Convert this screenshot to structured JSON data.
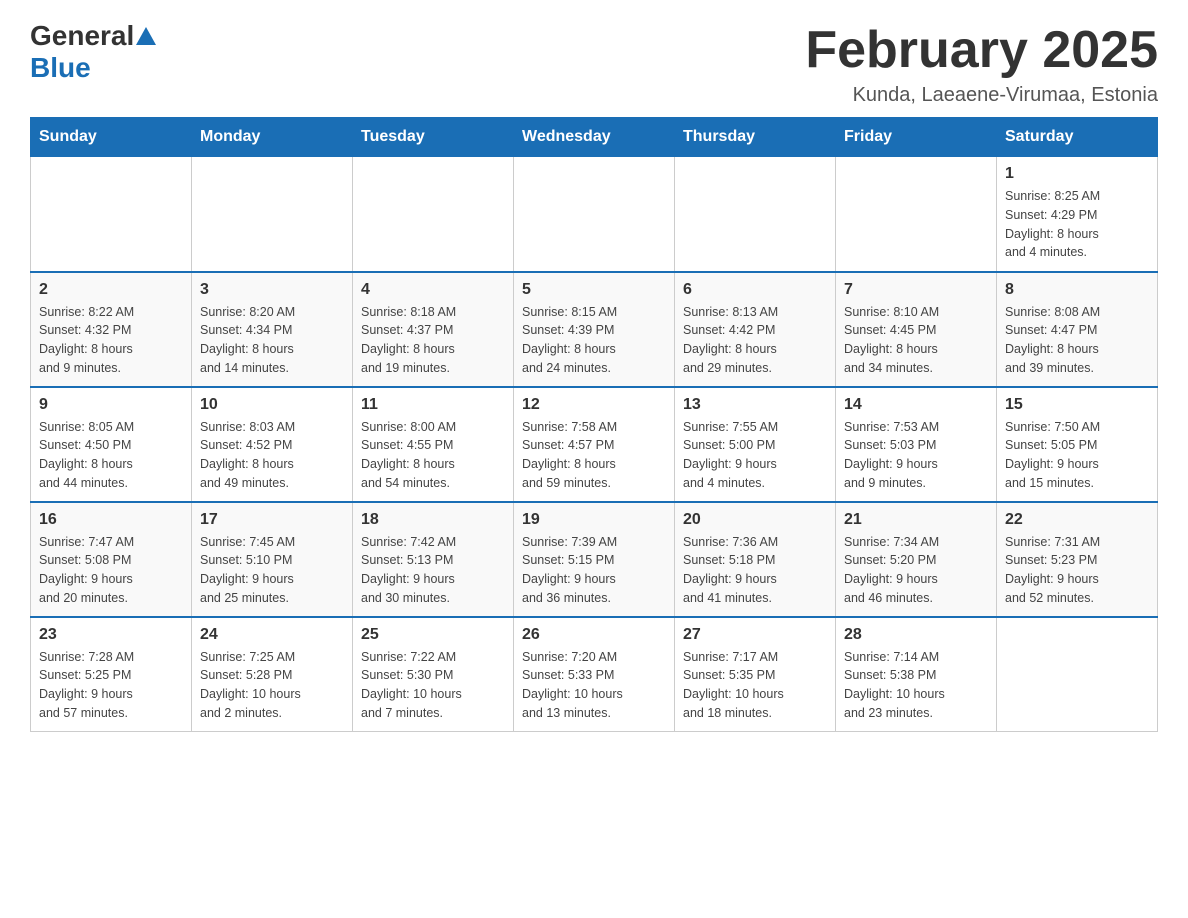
{
  "header": {
    "logo_general": "General",
    "logo_blue": "Blue",
    "month_title": "February 2025",
    "location": "Kunda, Laeaene-Virumaa, Estonia"
  },
  "days_of_week": [
    "Sunday",
    "Monday",
    "Tuesday",
    "Wednesday",
    "Thursday",
    "Friday",
    "Saturday"
  ],
  "weeks": [
    {
      "days": [
        {
          "date": "",
          "info": ""
        },
        {
          "date": "",
          "info": ""
        },
        {
          "date": "",
          "info": ""
        },
        {
          "date": "",
          "info": ""
        },
        {
          "date": "",
          "info": ""
        },
        {
          "date": "",
          "info": ""
        },
        {
          "date": "1",
          "info": "Sunrise: 8:25 AM\nSunset: 4:29 PM\nDaylight: 8 hours\nand 4 minutes."
        }
      ]
    },
    {
      "days": [
        {
          "date": "2",
          "info": "Sunrise: 8:22 AM\nSunset: 4:32 PM\nDaylight: 8 hours\nand 9 minutes."
        },
        {
          "date": "3",
          "info": "Sunrise: 8:20 AM\nSunset: 4:34 PM\nDaylight: 8 hours\nand 14 minutes."
        },
        {
          "date": "4",
          "info": "Sunrise: 8:18 AM\nSunset: 4:37 PM\nDaylight: 8 hours\nand 19 minutes."
        },
        {
          "date": "5",
          "info": "Sunrise: 8:15 AM\nSunset: 4:39 PM\nDaylight: 8 hours\nand 24 minutes."
        },
        {
          "date": "6",
          "info": "Sunrise: 8:13 AM\nSunset: 4:42 PM\nDaylight: 8 hours\nand 29 minutes."
        },
        {
          "date": "7",
          "info": "Sunrise: 8:10 AM\nSunset: 4:45 PM\nDaylight: 8 hours\nand 34 minutes."
        },
        {
          "date": "8",
          "info": "Sunrise: 8:08 AM\nSunset: 4:47 PM\nDaylight: 8 hours\nand 39 minutes."
        }
      ]
    },
    {
      "days": [
        {
          "date": "9",
          "info": "Sunrise: 8:05 AM\nSunset: 4:50 PM\nDaylight: 8 hours\nand 44 minutes."
        },
        {
          "date": "10",
          "info": "Sunrise: 8:03 AM\nSunset: 4:52 PM\nDaylight: 8 hours\nand 49 minutes."
        },
        {
          "date": "11",
          "info": "Sunrise: 8:00 AM\nSunset: 4:55 PM\nDaylight: 8 hours\nand 54 minutes."
        },
        {
          "date": "12",
          "info": "Sunrise: 7:58 AM\nSunset: 4:57 PM\nDaylight: 8 hours\nand 59 minutes."
        },
        {
          "date": "13",
          "info": "Sunrise: 7:55 AM\nSunset: 5:00 PM\nDaylight: 9 hours\nand 4 minutes."
        },
        {
          "date": "14",
          "info": "Sunrise: 7:53 AM\nSunset: 5:03 PM\nDaylight: 9 hours\nand 9 minutes."
        },
        {
          "date": "15",
          "info": "Sunrise: 7:50 AM\nSunset: 5:05 PM\nDaylight: 9 hours\nand 15 minutes."
        }
      ]
    },
    {
      "days": [
        {
          "date": "16",
          "info": "Sunrise: 7:47 AM\nSunset: 5:08 PM\nDaylight: 9 hours\nand 20 minutes."
        },
        {
          "date": "17",
          "info": "Sunrise: 7:45 AM\nSunset: 5:10 PM\nDaylight: 9 hours\nand 25 minutes."
        },
        {
          "date": "18",
          "info": "Sunrise: 7:42 AM\nSunset: 5:13 PM\nDaylight: 9 hours\nand 30 minutes."
        },
        {
          "date": "19",
          "info": "Sunrise: 7:39 AM\nSunset: 5:15 PM\nDaylight: 9 hours\nand 36 minutes."
        },
        {
          "date": "20",
          "info": "Sunrise: 7:36 AM\nSunset: 5:18 PM\nDaylight: 9 hours\nand 41 minutes."
        },
        {
          "date": "21",
          "info": "Sunrise: 7:34 AM\nSunset: 5:20 PM\nDaylight: 9 hours\nand 46 minutes."
        },
        {
          "date": "22",
          "info": "Sunrise: 7:31 AM\nSunset: 5:23 PM\nDaylight: 9 hours\nand 52 minutes."
        }
      ]
    },
    {
      "days": [
        {
          "date": "23",
          "info": "Sunrise: 7:28 AM\nSunset: 5:25 PM\nDaylight: 9 hours\nand 57 minutes."
        },
        {
          "date": "24",
          "info": "Sunrise: 7:25 AM\nSunset: 5:28 PM\nDaylight: 10 hours\nand 2 minutes."
        },
        {
          "date": "25",
          "info": "Sunrise: 7:22 AM\nSunset: 5:30 PM\nDaylight: 10 hours\nand 7 minutes."
        },
        {
          "date": "26",
          "info": "Sunrise: 7:20 AM\nSunset: 5:33 PM\nDaylight: 10 hours\nand 13 minutes."
        },
        {
          "date": "27",
          "info": "Sunrise: 7:17 AM\nSunset: 5:35 PM\nDaylight: 10 hours\nand 18 minutes."
        },
        {
          "date": "28",
          "info": "Sunrise: 7:14 AM\nSunset: 5:38 PM\nDaylight: 10 hours\nand 23 minutes."
        },
        {
          "date": "",
          "info": ""
        }
      ]
    }
  ]
}
